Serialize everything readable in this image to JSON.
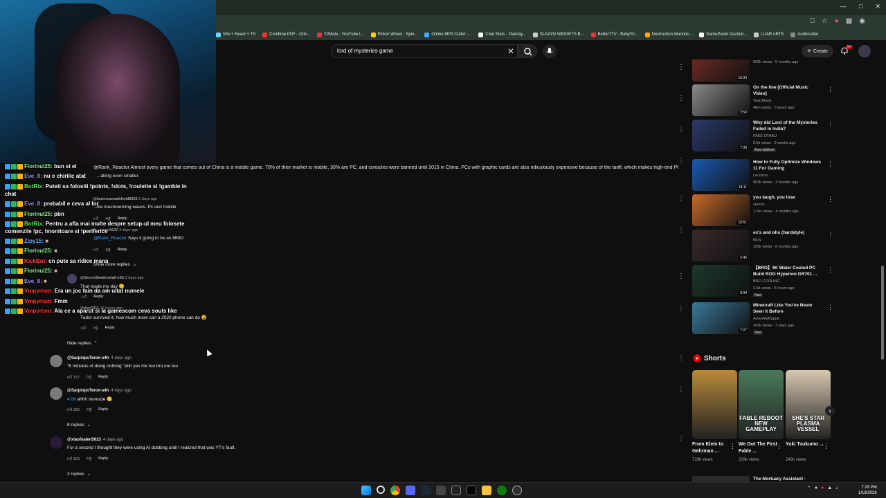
{
  "search": {
    "query": "lord of mysteries game"
  },
  "header": {
    "create_label": "Create",
    "notifications": "9+"
  },
  "bookmarks": [
    "Vite + React + TS",
    "Combine PDF - Onli...",
    "Y2Mate - YouTube t...",
    "Picker Wheel - Spin...",
    "Online MP3 Cutter -...",
    "Chat Stats - Overlay...",
    "SLAAYD WIDGETS B...",
    "BetterTTV - BabyYo...",
    "Destruction Warlock...",
    "GamePanel Gazduir...",
    "LUAR ARTS",
    "Audiocalter"
  ],
  "comments": {
    "main_tail": "@Rank_Reactor Almost every game that comes out of China is a mobile game. 70% of their market is mobile, 30% are PC, and consoles were banned until 2015 in China. PCs with graphic cards are also ridiculously expensive because of the tariff, which makes high-end PC",
    "main_tail_2": "...aking even smaller.",
    "reply1_author": "@karimsonsafehold9233",
    "reply1_time": "3 days ago",
    "reply1_text": "...the mushrooming waves. Pc and mobile",
    "reply1_reply": "Reply",
    "reply2_author": "@...angel4137",
    "reply2_time": "3 days ago",
    "reply2_text": "Says it going to be an MMO",
    "reply2_mention": "@Rank_Reactor",
    "reply2_reply": "Reply",
    "show_more": "Show more replies",
    "reply3_author": "@SecretSwallowtail-v3b",
    "reply3_time": "3 days ago",
    "reply3_text": "That made my day",
    "reply3_reply": "Reply",
    "reply4_author": "@dep7311",
    "reply4_time": "16 hours ago",
    "reply4_text": "Tudor survived it, how much more can a 2020 phone can do",
    "reply4_reply": "Reply",
    "hide_replies": "Hide replies",
    "c1_author": "@SarpinpoTeron-s4h",
    "c1_time": "4 days ago",
    "c1_text": "\"6 minutes of doing nothing \"ahh yes me too bro me too",
    "c1_likes": "157",
    "c1_reply": "Reply",
    "c2_author": "@SarpinpoTeron-s4h",
    "c2_time": "4 days ago",
    "c2_ts": "4:08",
    "c2_text": "ahhh monocle",
    "c2_likes": "329",
    "c2_reply": "Reply",
    "c2_replies": "8 replies",
    "c3_author": "@xiaofualen5623",
    "c3_time": "4 days ago",
    "c3_text": "For a second I thought they were using AI dubbing until I realized that was YT's fault.",
    "c3_likes": "193",
    "c3_reply": "Reply",
    "c3_replies": "2 replies"
  },
  "chat": [
    {
      "user": "Florinul25:",
      "msg": "bun si el",
      "color": "#8ff08f"
    },
    {
      "user": "Eve_8:",
      "msg": "nu e chirilic atat",
      "color": "#9b8cff"
    },
    {
      "user": "BotRix:",
      "msg": "Puteti sa folositi !points, !slots, !roulette si !gamble in",
      "color": "#5cf05c"
    },
    {
      "user": "",
      "msg": "chat",
      "color": "#fff"
    },
    {
      "user": "Eve_8:",
      "msg": "probabil e ceva al lor",
      "color": "#9b8cff"
    },
    {
      "user": "Florinul25:",
      "msg": "pbn",
      "color": "#8ff08f"
    },
    {
      "user": "BotRix:",
      "msg": "Pentru a afla mai multe despre setup-ul meu folosete",
      "color": "#5cf05c"
    },
    {
      "user": "",
      "msg": "comenzile !pc, !monitoare si !periferice",
      "color": "#fff"
    },
    {
      "user": "Zipy15:",
      "msg": "",
      "color": "#6ab4ff"
    },
    {
      "user": "Florinul25:",
      "msg": "",
      "color": "#8ff08f"
    },
    {
      "user": "KickBot:",
      "msg": "cn pute sa ridice mana",
      "color": "#ff4545"
    },
    {
      "user": "Florinul25:",
      "msg": "",
      "color": "#8ff08f"
    },
    {
      "user": "Eve_8:",
      "msg": "",
      "color": "#9b8cff"
    },
    {
      "user": "Vmpyrism:",
      "msg": "Era un joc fain da am uitat numele",
      "color": "#ff3a3a"
    },
    {
      "user": "Vmpyrism:",
      "msg": "Fmm",
      "color": "#ff3a3a"
    },
    {
      "user": "Vmpyrism:",
      "msg": "Ala ce a aparut si la gamescom ceva souls like",
      "color": "#ff3a3a"
    }
  ],
  "sidebar": [
    {
      "title": "",
      "channel": "",
      "meta": "506k views · 5 months ago",
      "duration": "16:34",
      "color": "#6a2a22"
    },
    {
      "title": "On the line [Official Music Video]",
      "channel": "Yeat Music",
      "meta": "46m views · 3 years ago",
      "duration": "2:50",
      "color": "#8a8a8a"
    },
    {
      "title": "Why did Lord of the Mysteries Failed in India?",
      "channel": "FAKE OTAKU",
      "meta": "5.6k views · 2 weeks ago",
      "badge": "Auto-dubbed",
      "duration": "7:08",
      "color": "#2a3a6a"
    },
    {
      "title": "How to Fully Optimize Windows 11 For Gaming",
      "channel": "Lecctron",
      "meta": "903k views · 3 months ago",
      "duration": "18:11",
      "color": "#1a5ab0"
    },
    {
      "title": "you laugh, you lose",
      "channel": "venom",
      "meta": "1.5m views · 4 months ago",
      "duration": "10:51",
      "color": "#c86a2a"
    },
    {
      "title": "ex's and ohs (hardstyle)",
      "channel": "tarzy",
      "meta": "120k views · 8 months ago",
      "duration": "2:45",
      "color": "#3a2a2a"
    },
    {
      "title": "【BRO】4K Water Cooled PC Build ROG Hyperion GR701 ...",
      "channel": "BRO COOLING",
      "meta": "3.9k views · 5 hours ago",
      "badge": "New",
      "duration": "8:09",
      "color": "#1a3a2a"
    },
    {
      "title": "Minecraft Like You've Never Seen It Before",
      "channel": "AsianHalfSquat",
      "meta": "241k views · 3 days ago",
      "badge": "New",
      "duration": "7:27",
      "color": "#3a7a9a"
    }
  ],
  "shorts": {
    "heading": "Shorts",
    "items": [
      {
        "title": "From Klein to Gehrman ...",
        "views": "729k views",
        "overlay": "",
        "color": "#b88a3a"
      },
      {
        "title": "We Got The First Fable ...",
        "views": "229k views",
        "overlay": "FABLE REBOOT NEW GAMEPLAY",
        "color": "#4a7a5a"
      },
      {
        "title": "Yuki Tsukumo ...",
        "views": "242k views",
        "overlay": "SHE'S STAR PLASMA VESSEL",
        "color": "#d8c8b0"
      }
    ],
    "peek_title": "The Mortuary Assistant -"
  },
  "taskbar": {
    "time": "7:29 PM",
    "date": "1/19/2026"
  }
}
